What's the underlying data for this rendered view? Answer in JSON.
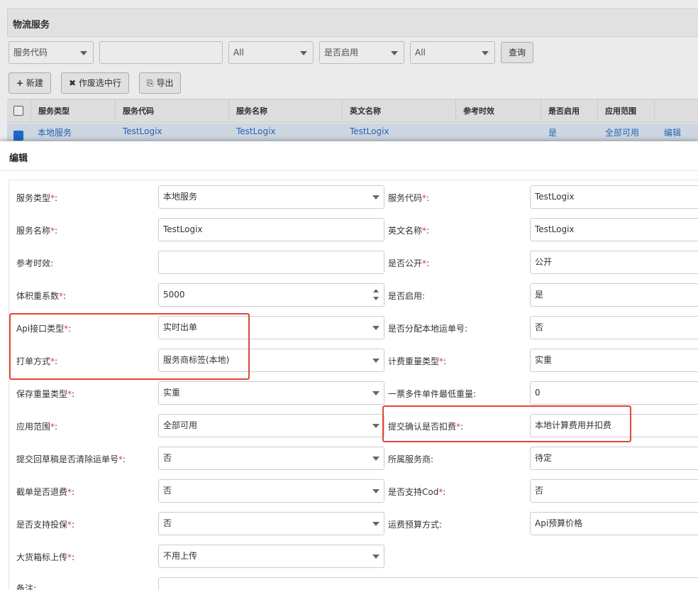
{
  "list_page": {
    "title": "物流服务",
    "filters": {
      "field_select": "服务代码",
      "search_value": "",
      "select_all_1": "All",
      "enabled_select": "是否启用",
      "select_all_2": "All",
      "query_button": "查询"
    },
    "toolbar": {
      "new_label": "新建",
      "void_label": "作废选中行",
      "export_label": "导出"
    },
    "table": {
      "columns": [
        "服务类型",
        "服务代码",
        "服务名称",
        "英文名称",
        "参考时效",
        "是否启用",
        "应用范围"
      ],
      "row": {
        "checked": true,
        "service_type": "本地服务",
        "service_code": "TestLogix",
        "service_name": "TestLogix",
        "english_name": "TestLogix",
        "ref_time": "",
        "enabled": "是",
        "scope": "全部可用",
        "action": "编辑"
      }
    }
  },
  "dialog": {
    "title": "编辑",
    "fields": {
      "service_type": {
        "label": "服务类型",
        "value": "本地服务"
      },
      "service_code": {
        "label": "服务代码",
        "value": "TestLogix"
      },
      "service_name": {
        "label": "服务名称",
        "value": "TestLogix"
      },
      "english_name": {
        "label": "英文名称",
        "value": "TestLogix"
      },
      "ref_time": {
        "label": "参考时效:",
        "value": ""
      },
      "is_public": {
        "label": "是否公开",
        "value": "公开"
      },
      "volume_coef": {
        "label": "体积重系数",
        "value": "5000"
      },
      "is_enabled": {
        "label": "是否启用:",
        "value": "是"
      },
      "api_type": {
        "label": "Api接口类型",
        "value": "实时出单"
      },
      "assign_local_no": {
        "label": "是否分配本地运单号:",
        "value": "否"
      },
      "print_method": {
        "label": "打单方式",
        "value": "服务商标签(本地)"
      },
      "billing_weight_type": {
        "label": "计费重量类型",
        "value": "实重"
      },
      "save_weight_type": {
        "label": "保存重量类型",
        "value": "实重"
      },
      "min_weight": {
        "label": "一票多件单件最低重量:",
        "value": "0"
      },
      "scope": {
        "label": "应用范围",
        "value": "全部可用"
      },
      "submit_deduct": {
        "label": "提交确认是否扣费",
        "value": "本地计算费用并扣费"
      },
      "draft_clear": {
        "label": "提交回草稿是否清除运单号",
        "value": "否"
      },
      "provider": {
        "label": "所属服务商:",
        "value": "待定"
      },
      "cutoff_refund": {
        "label": "截单是否退费",
        "value": "否"
      },
      "support_cod": {
        "label": "是否支持Cod",
        "value": "否"
      },
      "support_insure": {
        "label": "是否支持投保",
        "value": "否"
      },
      "freight_budget": {
        "label": "运费预算方式:",
        "value": "Api预算价格"
      },
      "cargo_label_upload": {
        "label": "大货箱标上传",
        "value": "不用上传"
      },
      "remark": {
        "label": "备注:",
        "value": ""
      }
    }
  },
  "colors": {
    "required": "#e53935",
    "highlight": "#e0463a",
    "link": "#2a6bc2",
    "checkbox": "#1e6fd9"
  }
}
